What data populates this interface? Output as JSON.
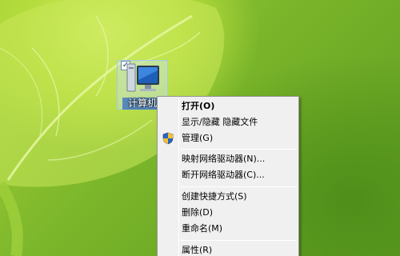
{
  "desktop": {
    "icon": {
      "label": "计算机",
      "icon": "computer-icon"
    }
  },
  "context_menu": {
    "items": [
      {
        "label": "打开(O)",
        "bold": true
      },
      {
        "label": "显示/隐藏 隐藏文件"
      },
      {
        "label": "管理(G)",
        "icon": "uac-shield-icon"
      },
      {
        "label": "映射网络驱动器(N)..."
      },
      {
        "label": "断开网络驱动器(C)..."
      },
      {
        "label": "创建快捷方式(S)"
      },
      {
        "label": "删除(D)"
      },
      {
        "label": "重命名(M)"
      },
      {
        "label": "属性(R)"
      }
    ]
  },
  "colors": {
    "wallpaper_green": "#7fb52a",
    "menu_background": "#f0f0f0",
    "selection_blue": "#336ec8"
  }
}
